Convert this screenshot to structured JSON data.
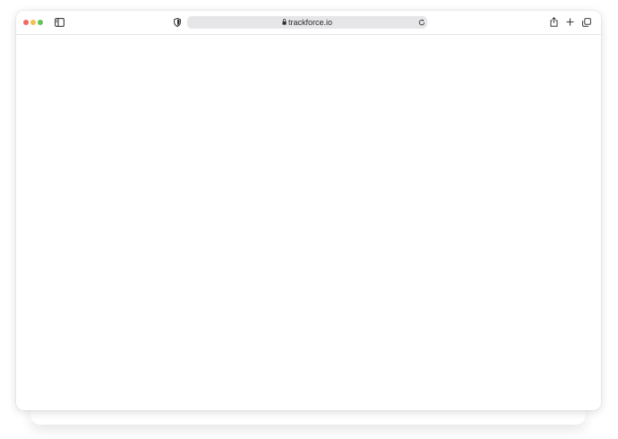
{
  "browser": {
    "url": "trackforce.io",
    "icons": {
      "sidebar": "sidebar-toggle-icon",
      "privacy": "shield-icon",
      "lock": "lock-icon",
      "reload": "reload-icon",
      "share": "share-icon",
      "new_tab": "plus-icon",
      "tab_overview": "tabs-overview-icon"
    },
    "colors": {
      "close": "#ee6a5f",
      "minimize": "#f5bf4f",
      "maximize": "#61c554",
      "address_bar": "#e6e6e9",
      "icon": "#3a3a3c"
    }
  },
  "page": {
    "content": ""
  }
}
